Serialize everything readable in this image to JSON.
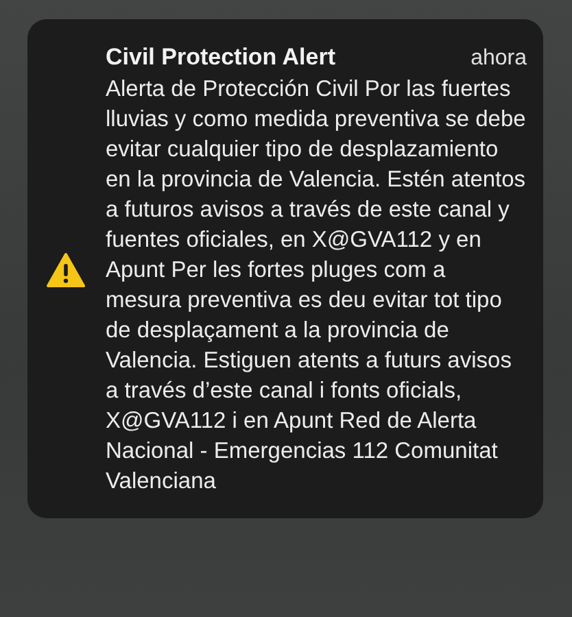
{
  "notification": {
    "title": "Civil Protection Alert",
    "time": "ahora",
    "body": "Alerta de Protección Civil Por las fuertes lluvias y como medida preventiva se debe evitar cualquier tipo de desplazamiento en la provincia de Valencia. Estén atentos a futuros avisos a través de este canal y fuentes oficiales, en X@GVA112 y en Apunt Per les fortes pluges com a mesura preventiva es deu evitar tot tipo de desplaçament a la provincia de Valencia. Estiguen atents a futurs avisos a través d’este canal i fonts oficials, X@GVA112 i en Apunt Red de Alerta Nacional - Emergencias 112 Comunitat Valenciana"
  }
}
